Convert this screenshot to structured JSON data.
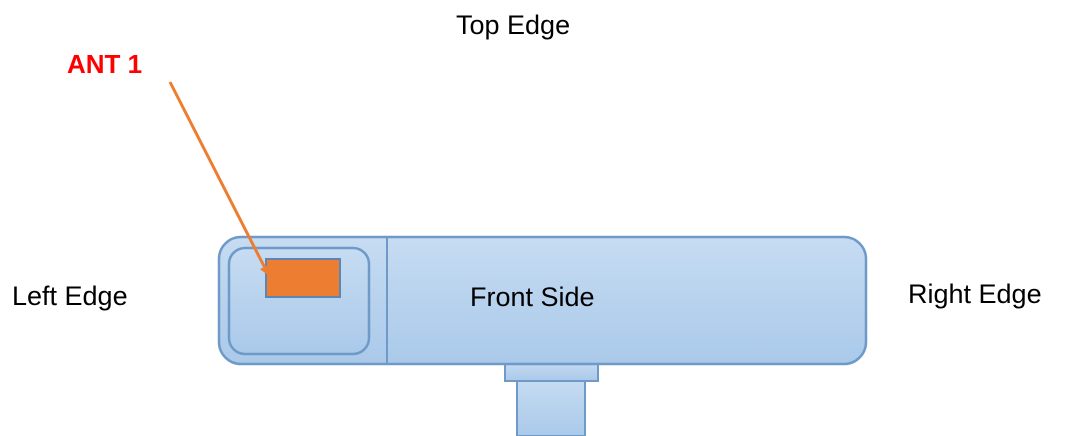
{
  "labels": {
    "top": "Top Edge",
    "left": "Left Edge",
    "right": "Right Edge",
    "front": "Front Side",
    "antenna": "ANT 1"
  },
  "colors": {
    "body_fill_top": "#c6dcf2",
    "body_fill_bottom": "#aac9ea",
    "body_stroke": "#6f9ac8",
    "antenna_fill": "#ed7d31",
    "arrow": "#ed7d31",
    "antenna_label": "#ff0000"
  }
}
